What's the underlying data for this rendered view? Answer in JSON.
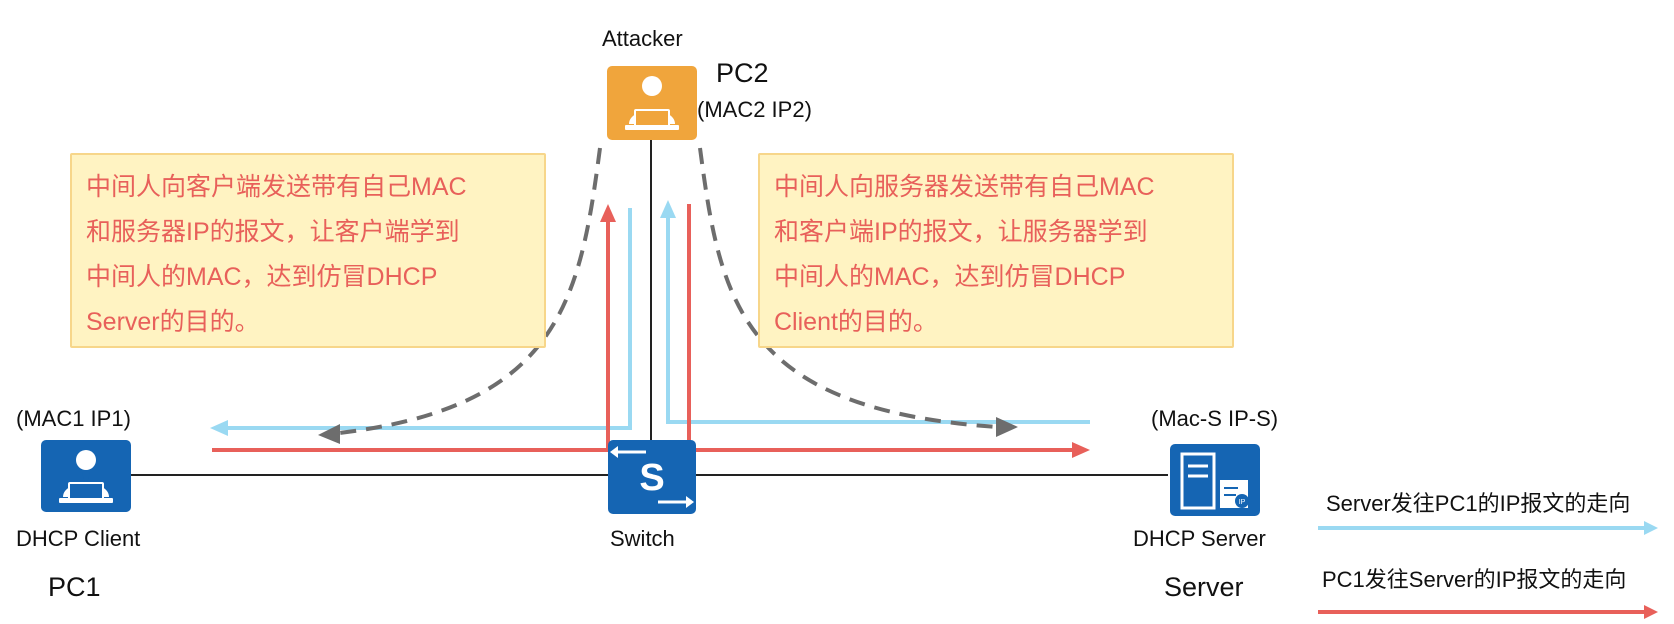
{
  "labels": {
    "attacker": "Attacker",
    "pc2": "PC2",
    "pc2_addr": "(MAC2 IP2)",
    "pc1_addr": "(MAC1 IP1)",
    "pc1_role": "DHCP Client",
    "pc1": "PC1",
    "switch": "Switch",
    "server_addr": "(Mac-S IP-S)",
    "server_role": "DHCP Server",
    "server": "Server"
  },
  "notes": {
    "left": [
      "中间人向客户端发送带有自己MAC",
      "和服务器IP的报文，让客户端学到",
      "中间人的MAC，达到仿冒DHCP",
      "Server的目的。"
    ],
    "right": [
      "中间人向服务器发送带有自己MAC",
      "和客户端IP的报文，让服务器学到",
      "中间人的MAC，达到仿冒DHCP",
      "Client的目的。"
    ]
  },
  "legend": {
    "blue_label": "Server发往PC1的IP报文的走向",
    "red_label": "PC1发往Server的IP报文的走向"
  },
  "colors": {
    "blue_flow": "#9ad9f2",
    "red_flow": "#e8605a",
    "attacker_flow": "#6d6d6d",
    "device_blue": "#1565b3",
    "attacker_orange": "#f0a53c",
    "note_text": "#e8605a"
  },
  "icons": {
    "pc1": "user-pc-icon",
    "pc2": "attacker-pc-icon",
    "switch": "switch-icon",
    "server": "server-icon"
  }
}
